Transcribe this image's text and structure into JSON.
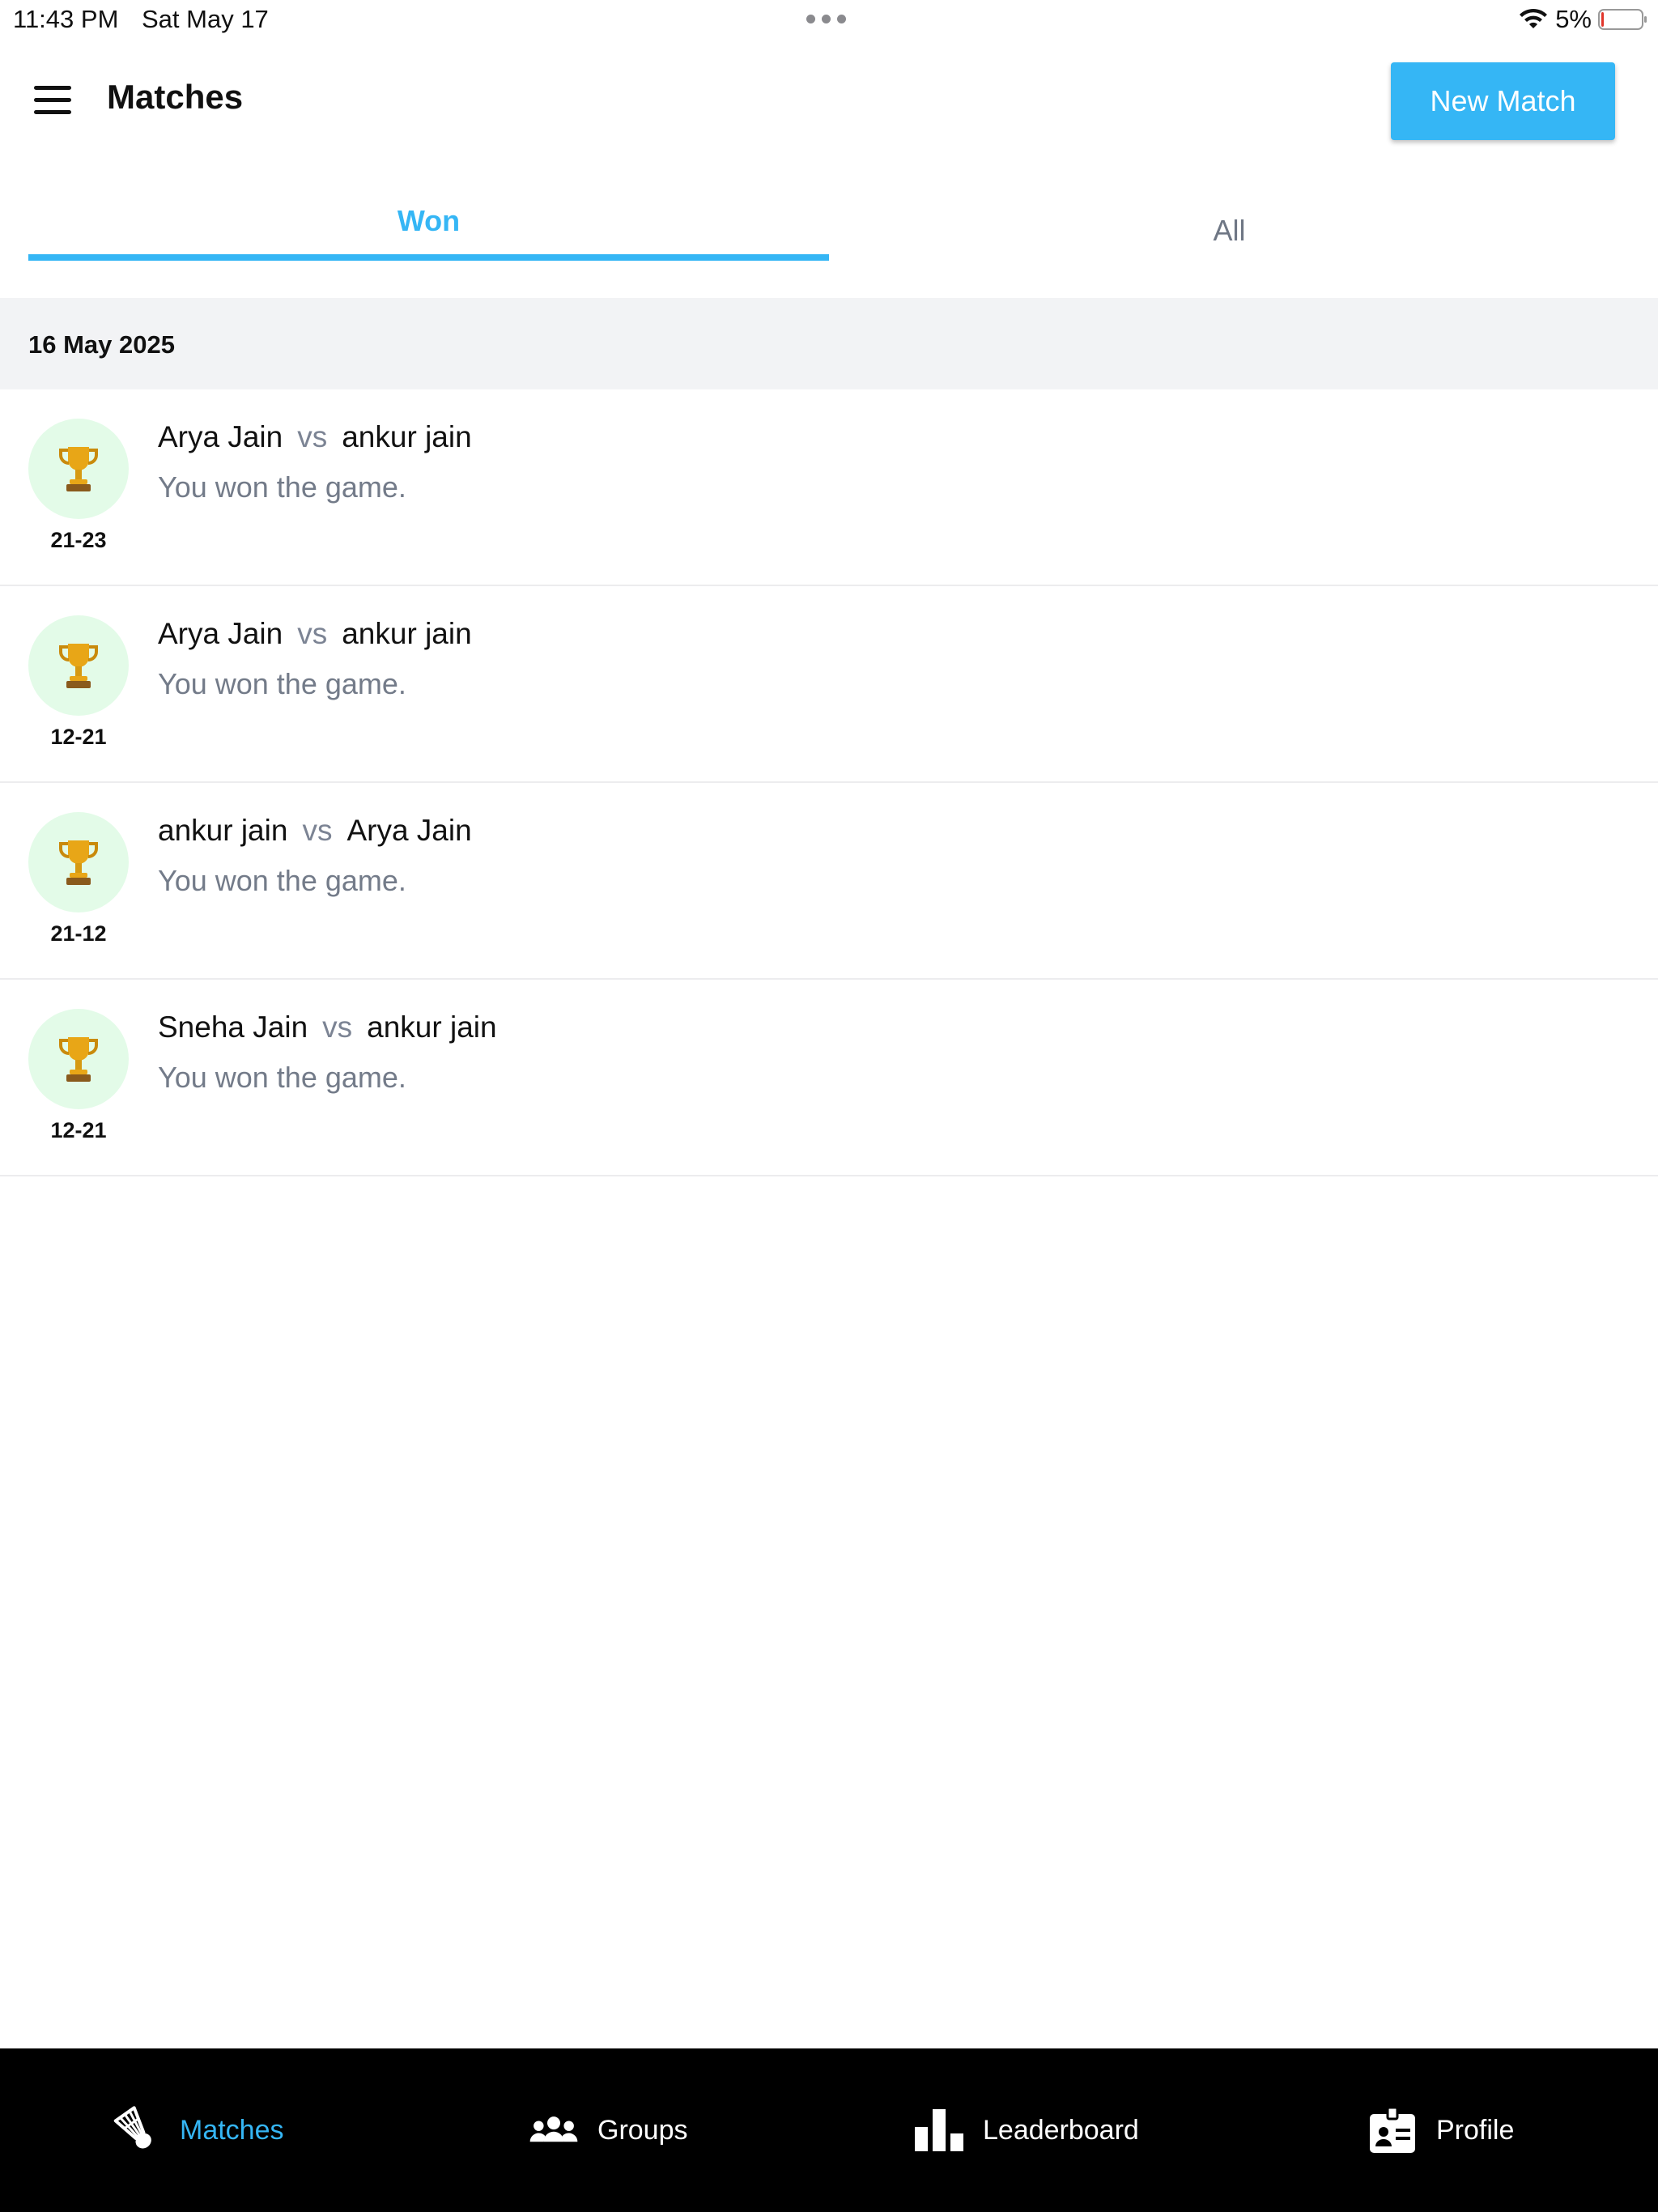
{
  "status_bar": {
    "time": "11:43 PM",
    "date": "Sat May 17",
    "battery_percent": "5%",
    "battery_level": 0.05
  },
  "header": {
    "title": "Matches",
    "new_match_label": "New Match"
  },
  "tabs": [
    {
      "label": "Won",
      "active": true
    },
    {
      "label": "All",
      "active": false
    }
  ],
  "section": {
    "date": "16 May 2025"
  },
  "matches": [
    {
      "player1": "Arya Jain",
      "vs": "vs",
      "player2": "ankur jain",
      "result": "You won the game.",
      "score": "21-23"
    },
    {
      "player1": "Arya Jain",
      "vs": "vs",
      "player2": "ankur jain",
      "result": "You won the game.",
      "score": "12-21"
    },
    {
      "player1": "ankur jain",
      "vs": "vs",
      "player2": "Arya Jain",
      "result": "You won the game.",
      "score": "21-12"
    },
    {
      "player1": "Sneha Jain",
      "vs": "vs",
      "player2": "ankur jain",
      "result": "You won the game.",
      "score": "12-21"
    }
  ],
  "bottom_nav": [
    {
      "label": "Matches",
      "icon": "shuttlecock-icon",
      "active": true
    },
    {
      "label": "Groups",
      "icon": "users-icon",
      "active": false
    },
    {
      "label": "Leaderboard",
      "icon": "bar-chart-icon",
      "active": false
    },
    {
      "label": "Profile",
      "icon": "id-badge-icon",
      "active": false
    }
  ],
  "colors": {
    "accent": "#35b6f5",
    "trophy_bg": "#e3fbe8",
    "nav_bg": "#000000"
  }
}
